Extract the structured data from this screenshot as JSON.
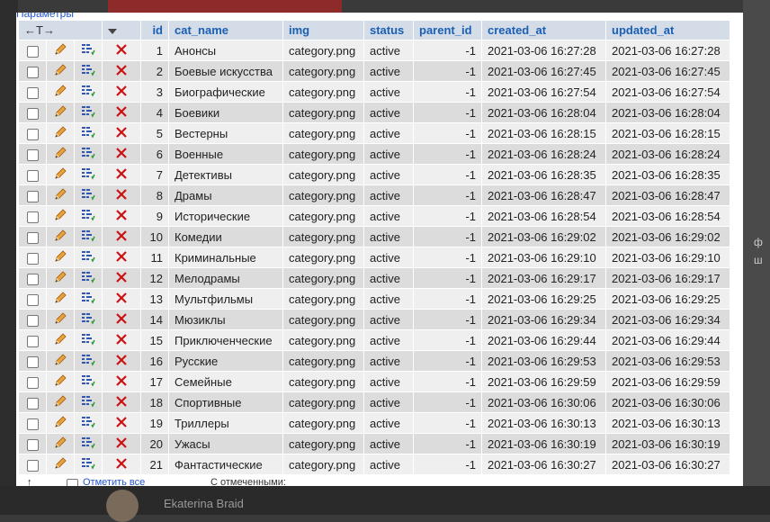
{
  "header": {
    "params_link": "Параметры",
    "arrows": "←T→",
    "columns": [
      "id",
      "cat_name",
      "img",
      "status",
      "parent_id",
      "created_at",
      "updated_at"
    ]
  },
  "rows": [
    {
      "id": "1",
      "cat_name": "Анонсы",
      "img": "category.png",
      "status": "active",
      "parent_id": "-1",
      "created_at": "2021-03-06 16:27:28",
      "updated_at": "2021-03-06 16:27:28"
    },
    {
      "id": "2",
      "cat_name": "Боевые искусства",
      "img": "category.png",
      "status": "active",
      "parent_id": "-1",
      "created_at": "2021-03-06 16:27:45",
      "updated_at": "2021-03-06 16:27:45"
    },
    {
      "id": "3",
      "cat_name": "Биографические",
      "img": "category.png",
      "status": "active",
      "parent_id": "-1",
      "created_at": "2021-03-06 16:27:54",
      "updated_at": "2021-03-06 16:27:54"
    },
    {
      "id": "4",
      "cat_name": "Боевики",
      "img": "category.png",
      "status": "active",
      "parent_id": "-1",
      "created_at": "2021-03-06 16:28:04",
      "updated_at": "2021-03-06 16:28:04"
    },
    {
      "id": "5",
      "cat_name": "Вестерны",
      "img": "category.png",
      "status": "active",
      "parent_id": "-1",
      "created_at": "2021-03-06 16:28:15",
      "updated_at": "2021-03-06 16:28:15"
    },
    {
      "id": "6",
      "cat_name": "Военные",
      "img": "category.png",
      "status": "active",
      "parent_id": "-1",
      "created_at": "2021-03-06 16:28:24",
      "updated_at": "2021-03-06 16:28:24"
    },
    {
      "id": "7",
      "cat_name": "Детективы",
      "img": "category.png",
      "status": "active",
      "parent_id": "-1",
      "created_at": "2021-03-06 16:28:35",
      "updated_at": "2021-03-06 16:28:35"
    },
    {
      "id": "8",
      "cat_name": "Драмы",
      "img": "category.png",
      "status": "active",
      "parent_id": "-1",
      "created_at": "2021-03-06 16:28:47",
      "updated_at": "2021-03-06 16:28:47"
    },
    {
      "id": "9",
      "cat_name": "Исторические",
      "img": "category.png",
      "status": "active",
      "parent_id": "-1",
      "created_at": "2021-03-06 16:28:54",
      "updated_at": "2021-03-06 16:28:54"
    },
    {
      "id": "10",
      "cat_name": "Комедии",
      "img": "category.png",
      "status": "active",
      "parent_id": "-1",
      "created_at": "2021-03-06 16:29:02",
      "updated_at": "2021-03-06 16:29:02"
    },
    {
      "id": "11",
      "cat_name": "Криминальные",
      "img": "category.png",
      "status": "active",
      "parent_id": "-1",
      "created_at": "2021-03-06 16:29:10",
      "updated_at": "2021-03-06 16:29:10"
    },
    {
      "id": "12",
      "cat_name": "Мелодрамы",
      "img": "category.png",
      "status": "active",
      "parent_id": "-1",
      "created_at": "2021-03-06 16:29:17",
      "updated_at": "2021-03-06 16:29:17"
    },
    {
      "id": "13",
      "cat_name": "Мультфильмы",
      "img": "category.png",
      "status": "active",
      "parent_id": "-1",
      "created_at": "2021-03-06 16:29:25",
      "updated_at": "2021-03-06 16:29:25"
    },
    {
      "id": "14",
      "cat_name": "Мюзиклы",
      "img": "category.png",
      "status": "active",
      "parent_id": "-1",
      "created_at": "2021-03-06 16:29:34",
      "updated_at": "2021-03-06 16:29:34"
    },
    {
      "id": "15",
      "cat_name": "Приключенческие",
      "img": "category.png",
      "status": "active",
      "parent_id": "-1",
      "created_at": "2021-03-06 16:29:44",
      "updated_at": "2021-03-06 16:29:44"
    },
    {
      "id": "16",
      "cat_name": "Русские",
      "img": "category.png",
      "status": "active",
      "parent_id": "-1",
      "created_at": "2021-03-06 16:29:53",
      "updated_at": "2021-03-06 16:29:53"
    },
    {
      "id": "17",
      "cat_name": "Семейные",
      "img": "category.png",
      "status": "active",
      "parent_id": "-1",
      "created_at": "2021-03-06 16:29:59",
      "updated_at": "2021-03-06 16:29:59"
    },
    {
      "id": "18",
      "cat_name": "Спортивные",
      "img": "category.png",
      "status": "active",
      "parent_id": "-1",
      "created_at": "2021-03-06 16:30:06",
      "updated_at": "2021-03-06 16:30:06"
    },
    {
      "id": "19",
      "cat_name": "Триллеры",
      "img": "category.png",
      "status": "active",
      "parent_id": "-1",
      "created_at": "2021-03-06 16:30:13",
      "updated_at": "2021-03-06 16:30:13"
    },
    {
      "id": "20",
      "cat_name": "Ужасы",
      "img": "category.png",
      "status": "active",
      "parent_id": "-1",
      "created_at": "2021-03-06 16:30:19",
      "updated_at": "2021-03-06 16:30:19"
    },
    {
      "id": "21",
      "cat_name": "Фантастические",
      "img": "category.png",
      "status": "active",
      "parent_id": "-1",
      "created_at": "2021-03-06 16:30:27",
      "updated_at": "2021-03-06 16:30:27"
    }
  ],
  "footer": {
    "check_all": "Отметить все",
    "with_selected": "С отмеченными:"
  },
  "background": {
    "user_name": "Ekaterina Braid",
    "right_snippet_1": "ф",
    "right_snippet_2": "ш"
  },
  "colors": {
    "header_bg": "#d4dce8",
    "header_text": "#1a5fb4",
    "row_odd": "#efefef",
    "row_even": "#dcdcdc",
    "delete_red": "#cc1111"
  },
  "icons": {
    "edit": "pencil-icon",
    "copy": "copy-icon",
    "delete": "delete-x-icon",
    "sort": "sort-down-icon",
    "back": "arrow-up-icon"
  }
}
